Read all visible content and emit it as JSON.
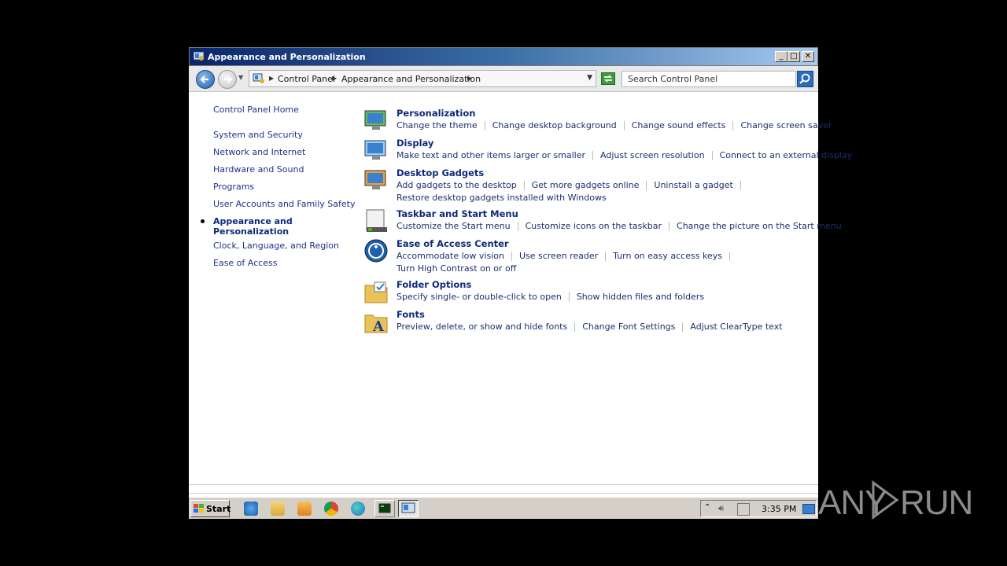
{
  "window": {
    "title": "Appearance and Personalization",
    "min": "_",
    "max": "□",
    "close": "✕"
  },
  "address": {
    "crumbs": [
      "Control Panel",
      "Appearance and Personalization"
    ],
    "search_placeholder": "Search Control Panel"
  },
  "sidebar": {
    "home": "Control Panel Home",
    "items": [
      "System and Security",
      "Network and Internet",
      "Hardware and Sound",
      "Programs",
      "User Accounts and Family Safety"
    ],
    "current_line1": "Appearance and",
    "current_line2": "Personalization",
    "after": [
      "Clock, Language, and Region",
      "Ease of Access"
    ]
  },
  "categories": [
    {
      "title": "Personalization",
      "icon": "personalization-icon",
      "lines": [
        [
          "Change the theme",
          "Change desktop background",
          "Change sound effects",
          "Change screen saver"
        ]
      ]
    },
    {
      "title": "Display",
      "icon": "display-icon",
      "lines": [
        [
          "Make text and other items larger or smaller",
          "Adjust screen resolution",
          "Connect to an external display"
        ]
      ]
    },
    {
      "title": "Desktop Gadgets",
      "icon": "gadgets-icon",
      "lines": [
        [
          "Add gadgets to the desktop",
          "Get more gadgets online",
          "Uninstall a gadget"
        ],
        [
          "Restore desktop gadgets installed with Windows"
        ]
      ]
    },
    {
      "title": "Taskbar and Start Menu",
      "icon": "taskbar-icon",
      "lines": [
        [
          "Customize the Start menu",
          "Customize icons on the taskbar",
          "Change the picture on the Start menu"
        ]
      ]
    },
    {
      "title": "Ease of Access Center",
      "icon": "ease-of-access-icon",
      "lines": [
        [
          "Accommodate low vision",
          "Use screen reader",
          "Turn on easy access keys"
        ],
        [
          "Turn High Contrast on or off"
        ]
      ]
    },
    {
      "title": "Folder Options",
      "icon": "folder-options-icon",
      "lines": [
        [
          "Specify single- or double-click to open",
          "Show hidden files and folders"
        ]
      ]
    },
    {
      "title": "Fonts",
      "icon": "fonts-icon",
      "lines": [
        [
          "Preview, delete, or show and hide fonts",
          "Change Font Settings",
          "Adjust ClearType text"
        ]
      ]
    }
  ],
  "taskbar": {
    "start": "Start",
    "clock": "3:35 PM"
  },
  "watermark": "ANY RUN"
}
